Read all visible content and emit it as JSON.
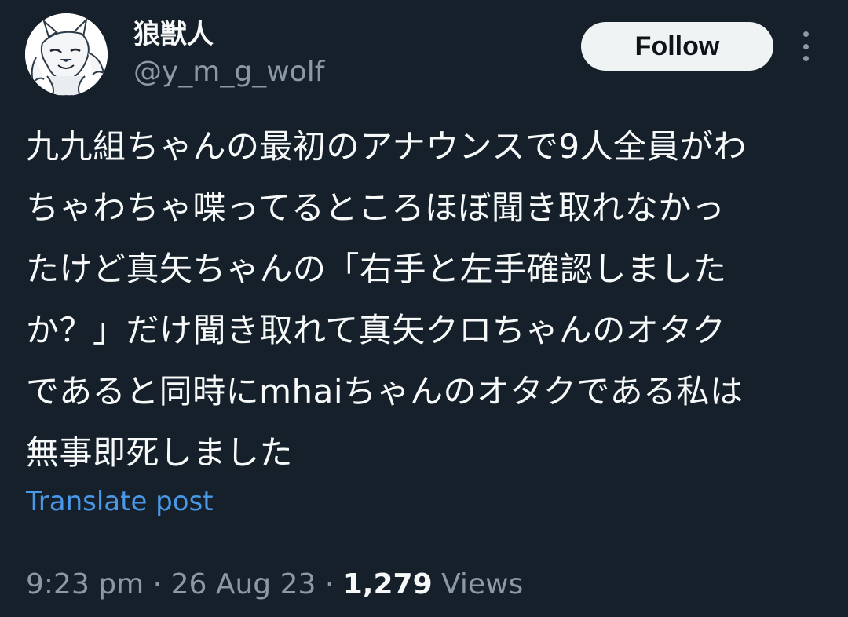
{
  "author": {
    "display_name": "狼獣人",
    "handle": "@y_m_g_wolf",
    "avatar_icon": "wolf-avatar-icon"
  },
  "actions": {
    "follow_label": "Follow",
    "more_icon": "more-vertical-icon"
  },
  "post": {
    "lines": [
      "九九組ちゃんの最初のアナウンスで9人全員がわ",
      "ちゃわちゃ喋ってるところほぼ聞き取れなかっ",
      "たけど真矢ちゃんの「右手と左手確認しました",
      "か？」だけ聞き取れて真矢クロちゃんのオタク",
      "であると同時にmhaiちゃんのオタクである私は",
      "無事即死しました"
    ],
    "translate_label": "Translate post"
  },
  "meta": {
    "time": "9:23 pm",
    "separator": "·",
    "date": "26 Aug 23",
    "views_count": "1,279",
    "views_label": "Views"
  },
  "colors": {
    "background": "#15202b",
    "primary_text": "#f7f9f9",
    "secondary_text": "#8b98a5",
    "link": "#4a99e9",
    "follow_button_bg": "#eff3f4",
    "follow_button_text": "#0f1419"
  }
}
